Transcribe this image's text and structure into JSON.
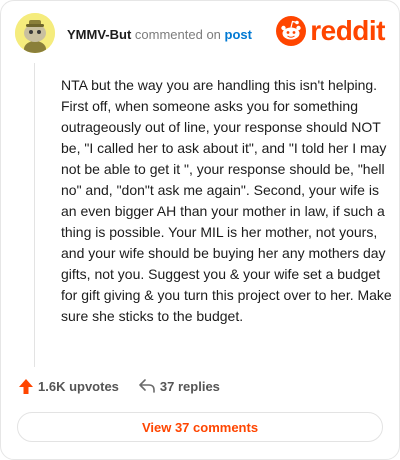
{
  "comment": {
    "username": "YMMV-But",
    "action_text": "commented on",
    "post_link_text": "post",
    "body": "NTA but the way you are handling this isn't helping. First off, when someone asks you for something outrageously out of line, your response should NOT be, \"I called her to ask about it\", and \"I told her I may not be able to get it \", your response should be, \"hell no\" and, \"don\"t ask me again\". Second, your wife is an even bigger AH than your mother in law, if such a thing is possible. Your MIL is her mother, not yours, and your wife should be buying her any mothers day gifts, not you. Suggest you & your wife set a budget for gift giving & you turn this project over to her. Make sure she sticks to the budget."
  },
  "brand": {
    "wordmark": "reddit",
    "accent_color": "#ff4500"
  },
  "actions": {
    "upvotes_label": "1.6K upvotes",
    "replies_label": "37 replies",
    "upvote_icon": "arrow-up-icon",
    "reply_icon": "reply-arrow-icon"
  },
  "view_button": {
    "label": "View 37 comments"
  },
  "colors": {
    "link": "#0079d3",
    "avatar_bg": "#f5ec7d"
  }
}
